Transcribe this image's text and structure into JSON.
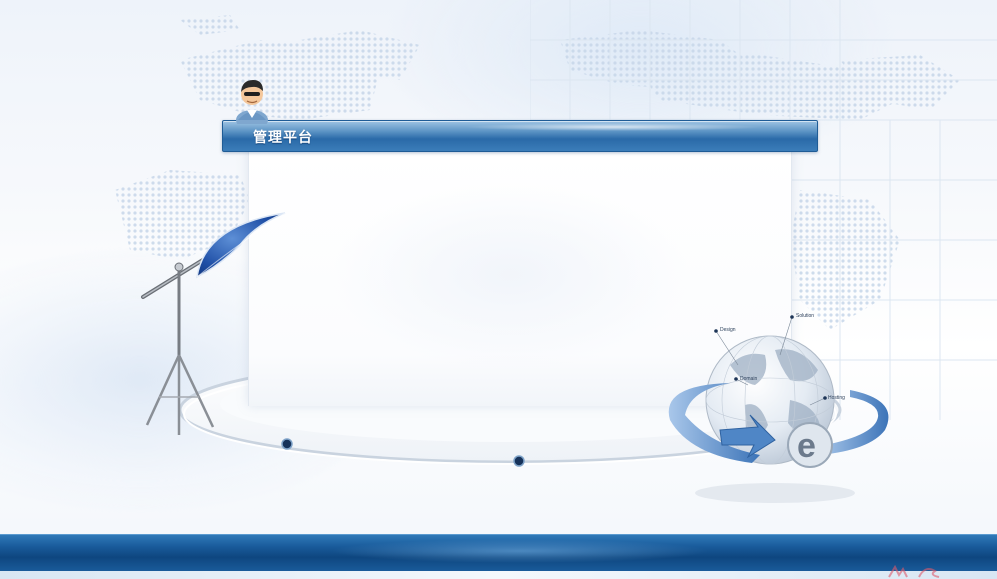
{
  "header": {
    "title": "管理平台"
  },
  "globe": {
    "labels": [
      "Design",
      "Solution",
      "Domain",
      "Hosting"
    ]
  },
  "colors": {
    "title_bar": "#2a6aa8",
    "bottom_bar": "#1a5c9c",
    "globe_arrow": "#4f86c6",
    "background": "#f7f9fc"
  },
  "icons": {
    "avatar": "user-avatar-icon",
    "light": "studio-umbrella-light-icon",
    "globe": "internet-globe-e-icon",
    "map": "dotted-world-map"
  }
}
